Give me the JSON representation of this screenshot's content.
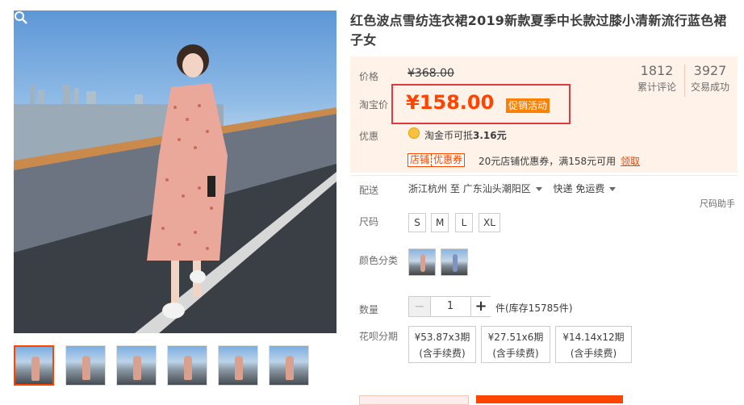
{
  "product": {
    "title": "红色波点雪纺连衣裙2019新款夏季中长款过膝小清新流行蓝色裙子女"
  },
  "price": {
    "original_label": "价格",
    "original_value": "¥368.00",
    "taobao_label": "淘宝价",
    "current_value": "¥158.00",
    "promo_tag": "促销活动",
    "accent_color": "#ff4400"
  },
  "stats": {
    "reviews_count": "1812",
    "reviews_label": "累计评论",
    "deals_count": "3927",
    "deals_label": "交易成功"
  },
  "discount": {
    "label": "优惠",
    "coin_icon": "taobao-coin-icon",
    "coin_text_prefix": "淘金币可抵",
    "coin_amount": "3.16元",
    "shop_tag_left": "店铺",
    "shop_tag_right": "优惠券",
    "coupon_text": "20元店铺优惠券，满158元可用",
    "coupon_link": "领取"
  },
  "shipping": {
    "label": "配送",
    "from": "浙江杭州",
    "to_word": "至",
    "to": "广东汕头潮阳区",
    "method": "快递 免运费"
  },
  "size": {
    "label": "尺码",
    "helper": "尺码助手",
    "options": [
      "S",
      "M",
      "L",
      "XL"
    ]
  },
  "color": {
    "label": "颜色分类"
  },
  "quantity": {
    "label": "数量",
    "minus": "−",
    "value": "1",
    "plus": "+",
    "stock_text": "件(库存15785件)"
  },
  "installment": {
    "label": "花呗分期",
    "options": [
      {
        "amount": "¥53.87x3期",
        "fee": "(含手续费)"
      },
      {
        "amount": "¥27.51x6期",
        "fee": "(含手续费)"
      },
      {
        "amount": "¥14.14x12期",
        "fee": "(含手续费)"
      }
    ]
  }
}
